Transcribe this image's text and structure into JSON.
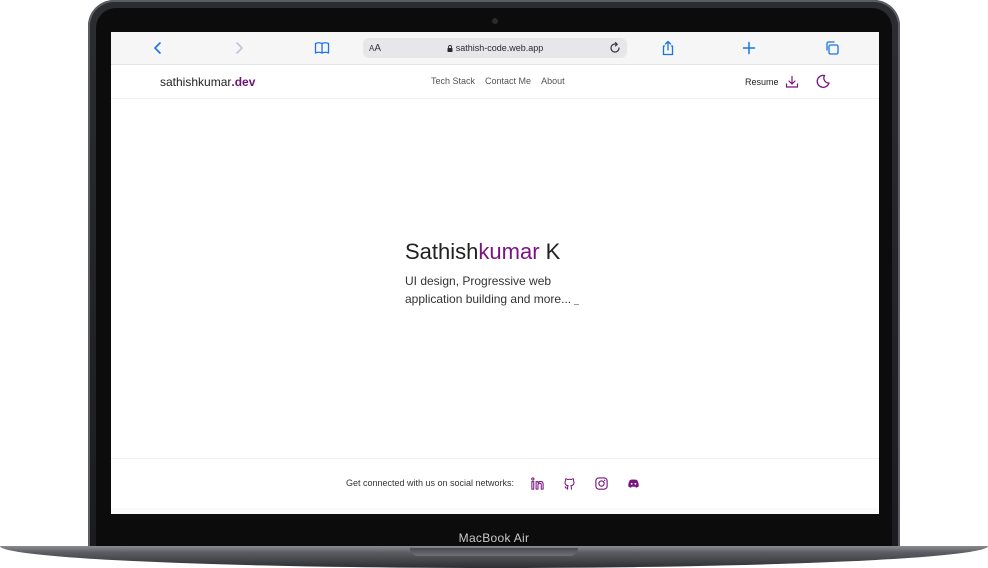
{
  "device": {
    "label": "MacBook Air"
  },
  "browser": {
    "url": "sathish-code.web.app",
    "aa_label": [
      "A",
      "A"
    ],
    "icons": [
      "back-icon",
      "forward-icon",
      "bookmarks-icon",
      "lock-icon",
      "reload-icon",
      "share-icon",
      "new-tab-icon",
      "tabs-icon"
    ]
  },
  "header": {
    "brand_name": "sathishkumar",
    "brand_tld": ".dev",
    "nav": [
      "Tech Stack",
      "Contact Me",
      "About"
    ],
    "resume_label": "Resume",
    "icons": [
      "download-icon",
      "moon-icon"
    ]
  },
  "hero": {
    "title_first": "Sathish",
    "title_accent": "kumar",
    "title_last": " K",
    "subtitle": "UI design, Progressive web application building and more..."
  },
  "footer": {
    "text": "Get connected with us on social networks:",
    "socials": [
      "linkedin-icon",
      "github-icon",
      "instagram-icon",
      "discord-icon"
    ]
  },
  "colors": {
    "accent": "#7a137f",
    "browser_blue": "#1a73e8",
    "toolbar_bg": "#f6f6f7",
    "text": "#222222"
  }
}
